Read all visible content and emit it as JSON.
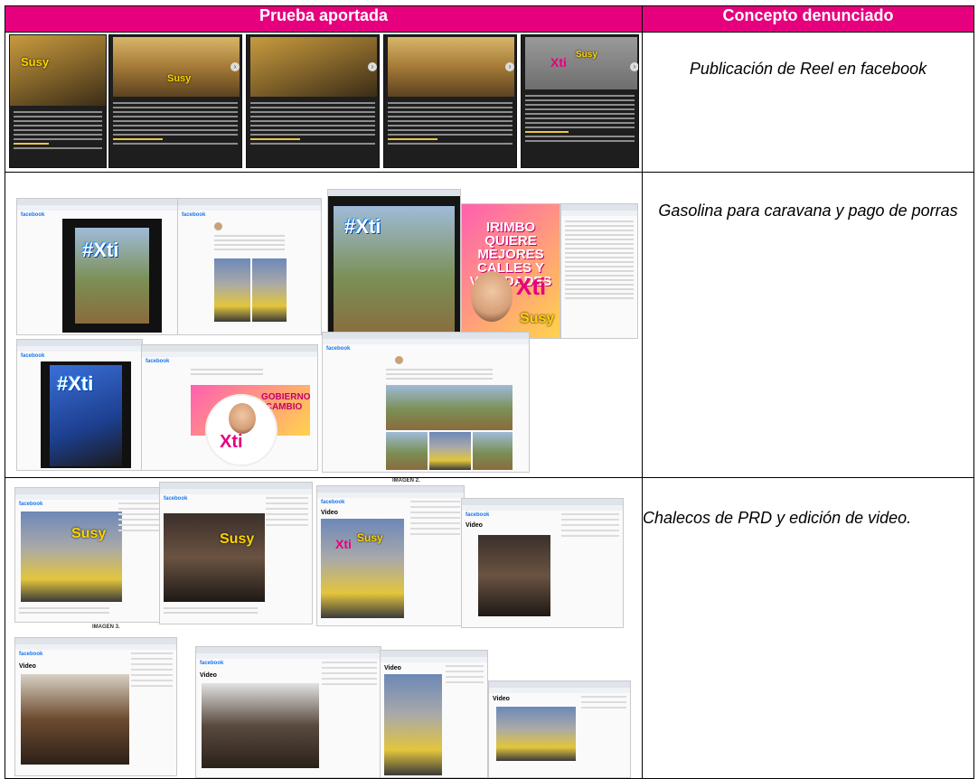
{
  "table": {
    "headers": {
      "evidence": "Prueba aportada",
      "concept": "Concepto denunciado"
    },
    "rows": [
      {
        "concept": "Publicación de Reel en facebook"
      },
      {
        "concept": "Gasolina para caravana y pago de porras"
      },
      {
        "concept": "Chalecos de PRD y edición de video."
      }
    ]
  },
  "labels": {
    "facebook": "facebook",
    "video": "Video",
    "hashtag": "#Xti",
    "brand_x": "Xti",
    "brand_name": "Susy",
    "poster_headline": "IRIMBO QUIERE MEJORES CALLES Y VIALIDADES",
    "poster2_headline": "GOBIERNO CAMBIO",
    "imagen2": "IMAGEN 2.",
    "imagen3": "IMAGEN 3."
  },
  "colors": {
    "header_bg": "#e6007e",
    "header_text": "#ffffff",
    "accent_yellow": "#ffd400"
  }
}
